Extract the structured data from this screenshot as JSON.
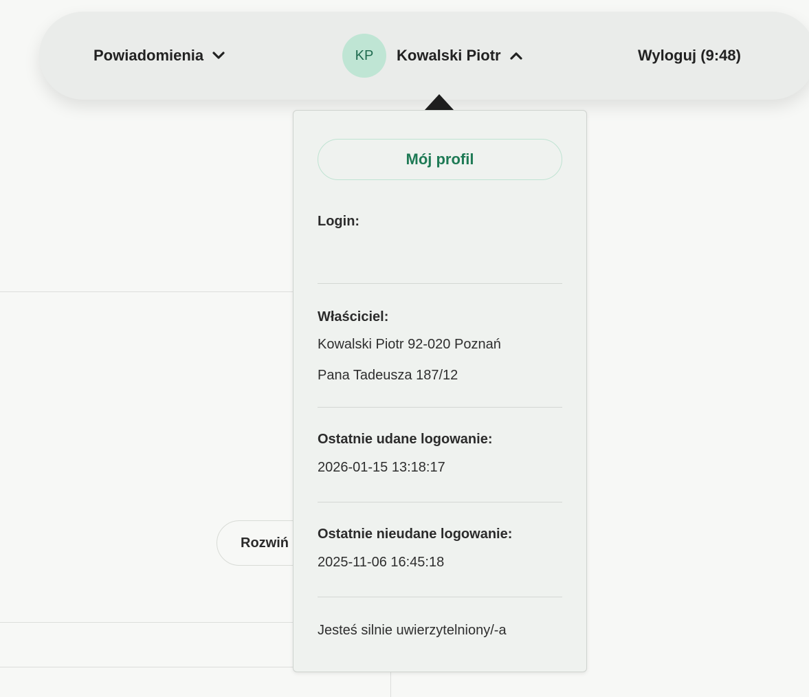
{
  "topbar": {
    "notifications_label": "Powiadomienia",
    "user_initials": "KP",
    "user_name": "Kowalski Piotr",
    "logout_label": "Wyloguj (9:48)"
  },
  "background": {
    "expand_button_label": "Rozwiń"
  },
  "user_menu": {
    "profile_button": "Mój profil",
    "login_label": "Login:",
    "login_value": "",
    "owner_label": "Właściciel:",
    "owner_line1": "Kowalski Piotr 92-020 Poznań",
    "owner_line2": "Pana Tadeusza 187/12",
    "last_success_label": "Ostatnie udane logowanie:",
    "last_success_value": "2026-01-15 13:18:17",
    "last_failed_label": "Ostatnie nieudane logowanie:",
    "last_failed_value": "2025-11-06 16:45:18",
    "auth_status": "Jesteś silnie uwierzytelniony/-a"
  },
  "colors": {
    "accent": "#1e7a55",
    "avatar_bg": "#bfe5d4"
  },
  "icons": {
    "notifications_chevron": "chevron-down-icon",
    "user_chevron": "chevron-up-icon"
  }
}
